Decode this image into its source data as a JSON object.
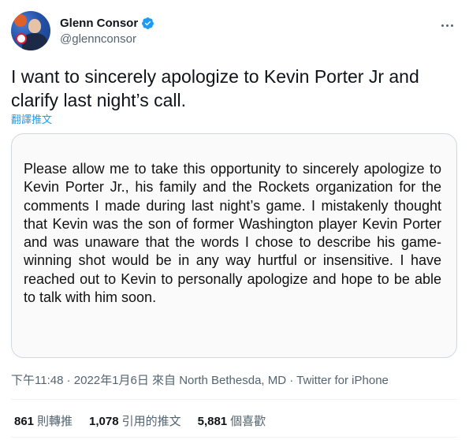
{
  "author": {
    "display_name": "Glenn Consor",
    "handle": "@glennconsor",
    "verified": true
  },
  "tweet": {
    "text": "I want to sincerely apologize to Kevin Porter Jr and clarify last night’s call.",
    "translate_label": "翻譯推文"
  },
  "media": {
    "statement": "Please allow me to take this opportunity to sincerely apologize to Kevin Porter Jr., his family and the Rockets organization for the comments I made during last night’s game. I mistakenly thought that Kevin was the son of former Washington player Kevin Porter and was unaware that the words I chose to describe his game-winning shot would be in any way hurtful or insensitive.  I have reached out to Kevin to personally apologize and hope to be able to talk with him soon."
  },
  "meta": {
    "time": "下午11:48",
    "dot": " · ",
    "date": "2022年1月6日",
    "from_prefix": " 來自 ",
    "location": "North Bethesda, MD",
    "source": "Twitter for iPhone"
  },
  "stats": {
    "retweets": {
      "count": "861",
      "label": "則轉推"
    },
    "quotes": {
      "count": "1,078",
      "label": "引用的推文"
    },
    "likes": {
      "count": "5,881",
      "label": "個喜歡"
    }
  },
  "colors": {
    "accent": "#1d9bf0",
    "secondary_text": "#536471",
    "border": "#cfd9de"
  },
  "icons": [
    "verified-badge-icon",
    "more-options-icon"
  ]
}
